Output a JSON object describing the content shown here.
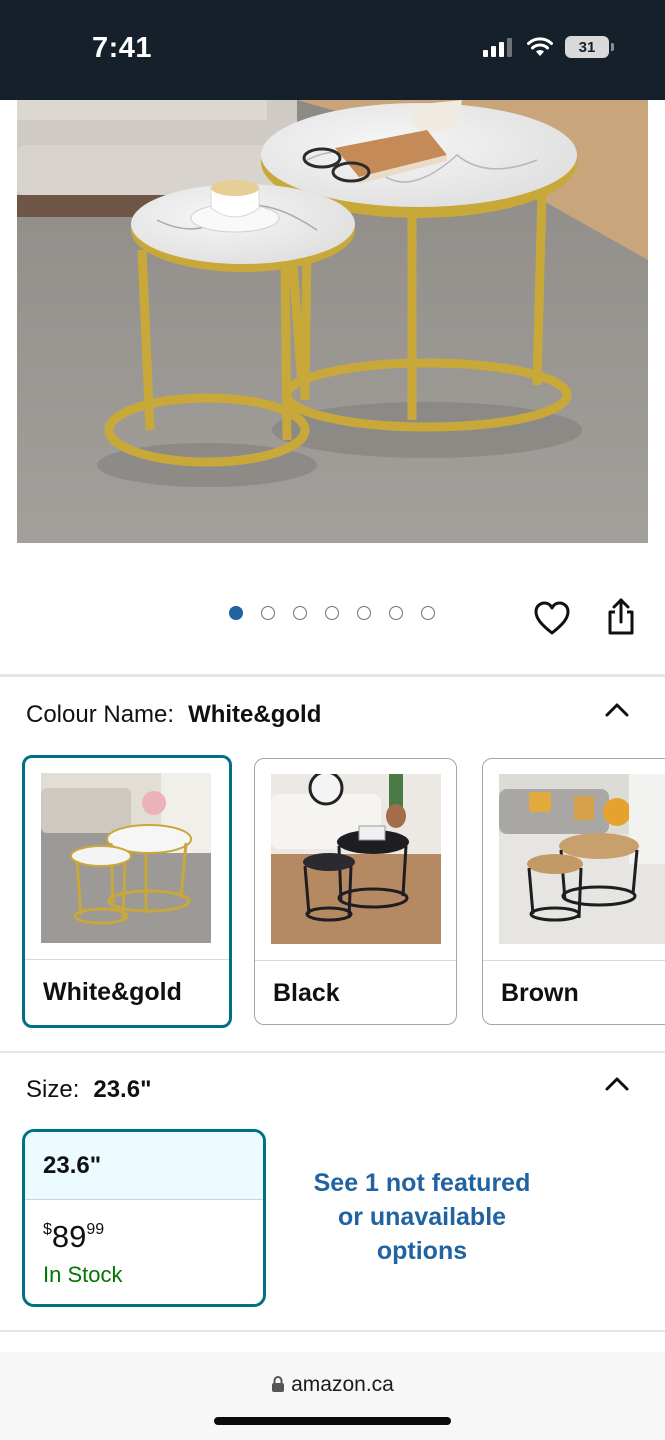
{
  "status_bar": {
    "time": "7:41",
    "battery": "31"
  },
  "carousel": {
    "dot_count": 7,
    "active_index": 0
  },
  "colour": {
    "label": "Colour Name:",
    "value": "White&gold",
    "options": [
      {
        "label": "White&gold",
        "selected": true
      },
      {
        "label": "Black",
        "selected": false
      },
      {
        "label": "Brown",
        "selected": false
      }
    ]
  },
  "size": {
    "label": "Size:",
    "value": "23.6\"",
    "option": {
      "label": "23.6\"",
      "price_symbol": "$",
      "price_whole": "89",
      "price_cents": "99",
      "availability": "In Stock"
    },
    "see_more": "See 1 not featured or unavailable options"
  },
  "browser": {
    "url": "amazon.ca"
  },
  "colors": {
    "accent": "#007185",
    "link": "#2162a1",
    "in_stock": "#007600",
    "status_bar_bg": "#15202a"
  },
  "icons": [
    "signal-icon",
    "wifi-icon",
    "battery-icon",
    "heart-icon",
    "share-icon",
    "chevron-up-icon",
    "lock-icon"
  ]
}
